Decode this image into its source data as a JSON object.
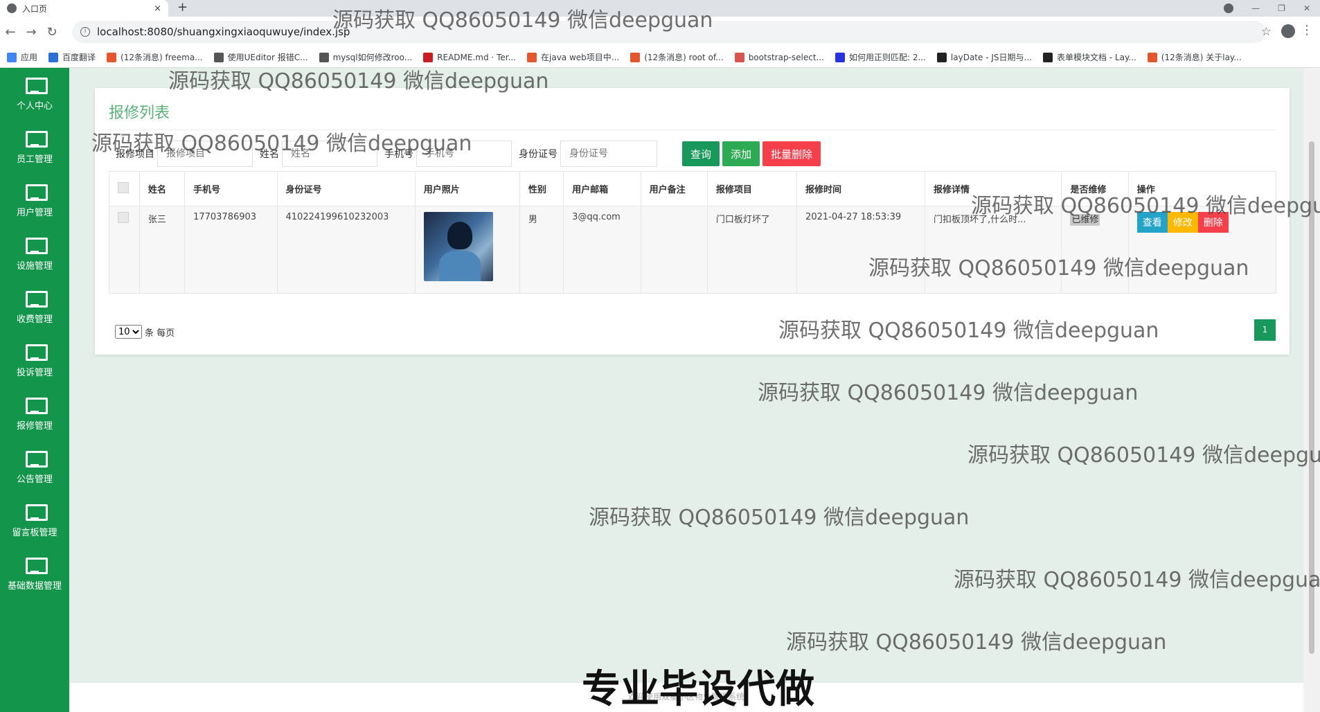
{
  "browser": {
    "tab_title": "入口页",
    "tab_close": "×",
    "new_tab": "+",
    "url": "localhost:8080/shuangxingxiaoquwuye/index.jsp",
    "bookmarks": [
      {
        "label": "应用",
        "color": "#4285f4"
      },
      {
        "label": "百度翻译",
        "color": "#2b6fd6"
      },
      {
        "label": "(12条消息) freema...",
        "color": "#e4572e"
      },
      {
        "label": "使用UEditor 报错C...",
        "color": "#555555"
      },
      {
        "label": "mysql如何修改roo...",
        "color": "#555555"
      },
      {
        "label": "README.md · Ter...",
        "color": "#c71d23"
      },
      {
        "label": "在java web项目中...",
        "color": "#e4572e"
      },
      {
        "label": "(12条消息) root of...",
        "color": "#e4572e"
      },
      {
        "label": "bootstrap-select...",
        "color": "#d9534f"
      },
      {
        "label": "如何用正则匹配: 2...",
        "color": "#2932e1"
      },
      {
        "label": "layDate - JS日期与...",
        "color": "#222222"
      },
      {
        "label": "表单模块文档 - Lay...",
        "color": "#222222"
      },
      {
        "label": "(12条消息) 关于lay...",
        "color": "#e4572e"
      }
    ]
  },
  "sidebar": {
    "items": [
      {
        "label": "个人中心"
      },
      {
        "label": "员工管理"
      },
      {
        "label": "用户管理"
      },
      {
        "label": "设施管理"
      },
      {
        "label": "收费管理"
      },
      {
        "label": "投诉管理"
      },
      {
        "label": "报修管理"
      },
      {
        "label": "公告管理"
      },
      {
        "label": "留言板管理"
      },
      {
        "label": "基础数据管理"
      }
    ]
  },
  "panel": {
    "title": "报修列表",
    "search": {
      "project_label": "报修项目",
      "project_placeholder": "报修项目",
      "name_label": "姓名",
      "name_placeholder": "姓名",
      "phone_label": "手机号",
      "phone_placeholder": "手机号",
      "id_label": "身份证号",
      "id_placeholder": "身份证号",
      "query_btn": "查询",
      "add_btn": "添加",
      "batch_delete_btn": "批量删除"
    },
    "table": {
      "headers": [
        "姓名",
        "手机号",
        "身份证号",
        "用户照片",
        "性别",
        "用户邮箱",
        "用户备注",
        "报修项目",
        "报修时间",
        "报修详情",
        "是否维修",
        "操作"
      ],
      "rows": [
        {
          "name": "张三",
          "phone": "17703786903",
          "id_card": "410224199610232003",
          "gender": "男",
          "email": "3@qq.com",
          "remark": "",
          "project": "门口板灯坏了",
          "time": "2021-04-27 18:53:39",
          "detail": "门扣板顶坏了,什么时...",
          "status": "已维修",
          "view": "查看",
          "edit": "修改",
          "delete": "删除"
        }
      ]
    },
    "pager": {
      "page_size": "10",
      "page_size_options": [
        "10"
      ],
      "per_page_text": "条 每页",
      "current_page": "1"
    }
  },
  "footer": {
    "text": "欢迎使用双星小区物业管理系统"
  },
  "watermark": "源码获取 QQ86050149 微信deepguan",
  "promo": "专业毕设代做",
  "colors": {
    "sidebar": "#13964b",
    "accent_green": "#18995b",
    "danger": "#f5404c",
    "info": "#24a3c9",
    "warning": "#ffb800"
  }
}
